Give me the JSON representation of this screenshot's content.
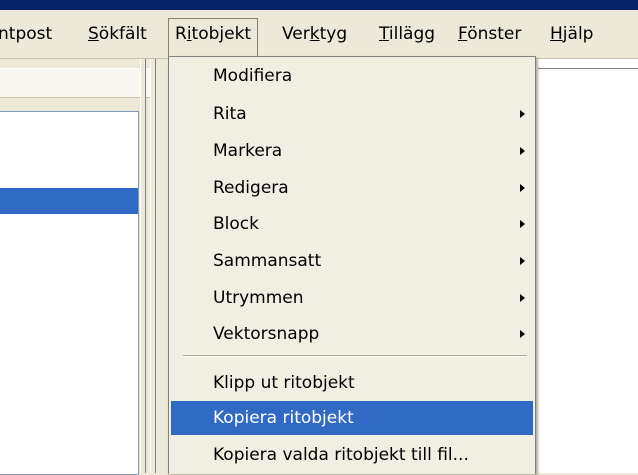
{
  "menubar": {
    "items": [
      {
        "pre": "",
        "acc": "",
        "post": "ntpost"
      },
      {
        "pre": "",
        "acc": "S",
        "post": "ökfält"
      },
      {
        "pre": "R",
        "acc": "i",
        "post": "tobjekt"
      },
      {
        "pre": "Ver",
        "acc": "k",
        "post": "tyg"
      },
      {
        "pre": "",
        "acc": "T",
        "post": "illägg"
      },
      {
        "pre": "",
        "acc": "F",
        "post": "önster"
      },
      {
        "pre": "",
        "acc": "H",
        "post": "jälp"
      }
    ]
  },
  "dropdown": {
    "items": [
      {
        "label": "Modifiera"
      },
      {
        "label": "Rita"
      },
      {
        "label": "Markera"
      },
      {
        "label": "Redigera"
      },
      {
        "label": "Block"
      },
      {
        "label": "Sammansatt"
      },
      {
        "label": "Utrymmen"
      },
      {
        "label": "Vektorsnapp"
      },
      {
        "label": "Klipp ut ritobjekt"
      },
      {
        "label": "Kopiera ritobjekt"
      },
      {
        "label": "Kopiera valda ritobjekt till fil..."
      }
    ]
  },
  "colors": {
    "highlight": "#316ac5",
    "title_bar": "#0a246a"
  }
}
